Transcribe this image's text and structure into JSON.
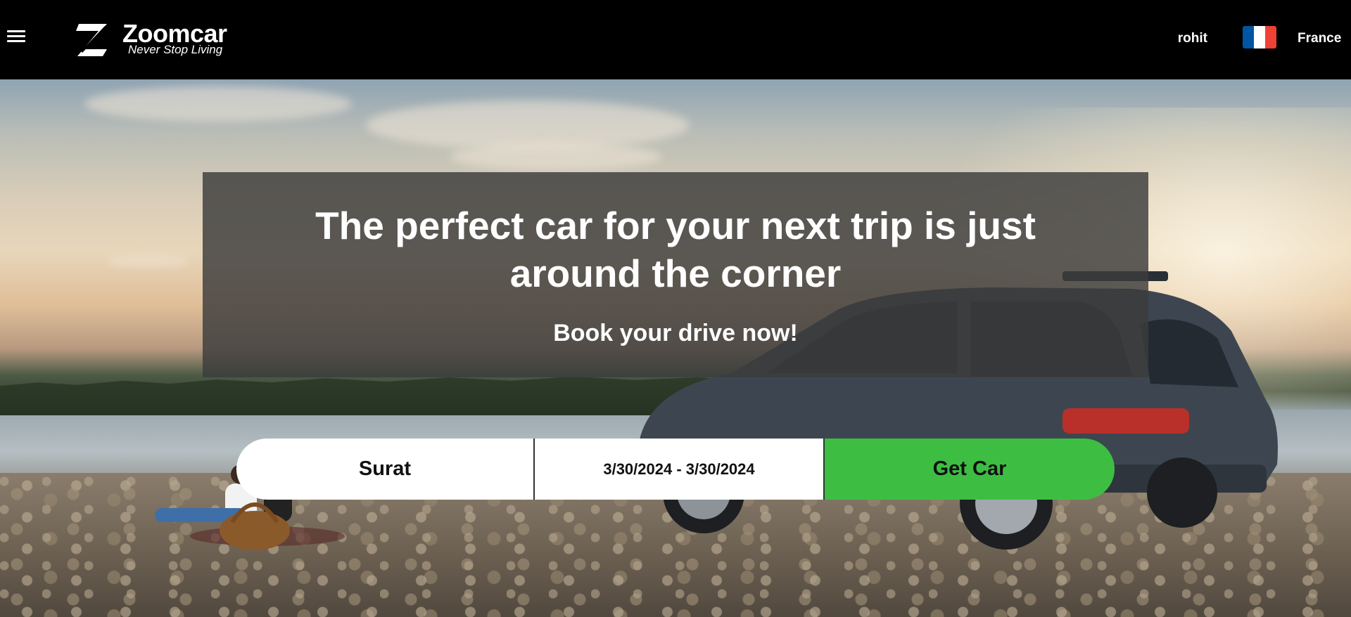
{
  "header": {
    "menu_icon": "hamburger-menu-icon",
    "logo": {
      "name": "Zoomcar",
      "tagline": "Never Stop Living",
      "icon": "zoomcar-z-logo-icon"
    },
    "user_name": "rohit",
    "country": "France",
    "flag_colors": [
      "#0055a4",
      "#ffffff",
      "#ef4135"
    ]
  },
  "hero": {
    "headline": "The perfect car for your next trip is just around the corner",
    "subheadline": "Book your drive now!"
  },
  "search": {
    "city": "Surat",
    "date_range": "3/30/2024 - 3/30/2024",
    "submit_label": "Get Car"
  },
  "colors": {
    "header_bg": "#000000",
    "cta_green": "#3dbe43",
    "overlay": "rgba(60,60,60,0.82)"
  }
}
